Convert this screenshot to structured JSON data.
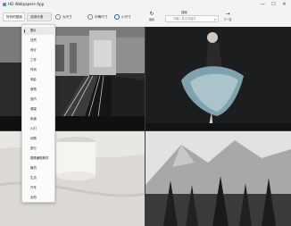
{
  "window": {
    "title": "HD Wallpapers App"
  },
  "title_controls": {
    "minimize": "—",
    "maximize": "☐",
    "close": "✕"
  },
  "toolbar": {
    "source_combo": "所有的壁纸",
    "category_combo": "选择分类",
    "size_options": [
      {
        "label": "大尺寸",
        "selected": false
      },
      {
        "label": "中等尺寸",
        "selected": false
      },
      {
        "label": "小尺寸",
        "selected": true
      }
    ],
    "refresh_label": "刷新",
    "next_label": "下一页",
    "search_label": "搜索",
    "search_placeholder": "请输入英文关键字"
  },
  "menu": {
    "items": [
      {
        "label": "图片",
        "active": true
      },
      {
        "label": "自然",
        "active": false
      },
      {
        "label": "商业",
        "active": false
      },
      {
        "label": "工作",
        "active": false
      },
      {
        "label": "时尚",
        "active": false
      },
      {
        "label": "电影",
        "active": false
      },
      {
        "label": "食物",
        "active": false
      },
      {
        "label": "室内",
        "active": false
      },
      {
        "label": "健康",
        "active": false
      },
      {
        "label": "街道",
        "active": false
      },
      {
        "label": "人们",
        "active": false
      },
      {
        "label": "动物",
        "active": false
      },
      {
        "label": "旅行",
        "active": false
      },
      {
        "label": "图像编辑素材",
        "active": false
      },
      {
        "label": "最热",
        "active": false
      },
      {
        "label": "生活",
        "active": false
      },
      {
        "label": "汽车",
        "active": false
      },
      {
        "label": "太阳",
        "active": false
      }
    ]
  },
  "colors": {
    "accent": "#005fb8"
  },
  "icons": {
    "refresh": "refresh-icon",
    "next": "arrow-right-icon",
    "search": "search-icon"
  }
}
